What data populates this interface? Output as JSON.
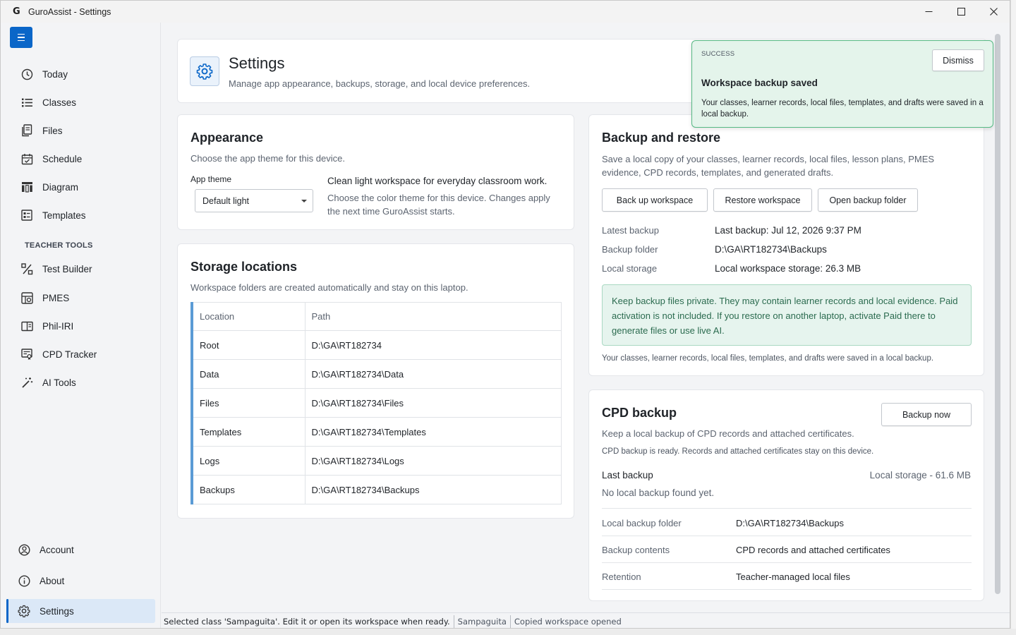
{
  "window": {
    "title": "GuroAssist - Settings"
  },
  "sidebar": {
    "items": [
      {
        "label": "Today",
        "icon": "clock-icon"
      },
      {
        "label": "Classes",
        "icon": "list-icon"
      },
      {
        "label": "Files",
        "icon": "files-icon"
      },
      {
        "label": "Schedule",
        "icon": "calendar-icon"
      },
      {
        "label": "Diagram",
        "icon": "diagram-icon"
      },
      {
        "label": "Templates",
        "icon": "template-icon"
      }
    ],
    "section_label": "TEACHER TOOLS",
    "tools": [
      {
        "label": "Test Builder",
        "icon": "percent-icon"
      },
      {
        "label": "PMES",
        "icon": "pmes-icon"
      },
      {
        "label": "Phil-IRI",
        "icon": "book-icon"
      },
      {
        "label": "CPD Tracker",
        "icon": "certificate-icon"
      },
      {
        "label": "AI Tools",
        "icon": "magic-wand-icon"
      }
    ],
    "bottom": [
      {
        "label": "Account",
        "icon": "user-icon"
      },
      {
        "label": "About",
        "icon": "info-icon"
      },
      {
        "label": "Settings",
        "icon": "gear-icon",
        "active": true
      }
    ]
  },
  "header": {
    "title": "Settings",
    "subtitle": "Manage app appearance, backups, storage, and local device preferences."
  },
  "appearance": {
    "title": "Appearance",
    "subtitle": "Choose the app theme for this device.",
    "theme_label": "App theme",
    "theme_value": "Default light",
    "description_title": "Clean light workspace for everyday classroom work.",
    "description_text": "Choose the color theme for this device. Changes apply the next time GuroAssist starts."
  },
  "storage": {
    "title": "Storage locations",
    "subtitle": "Workspace folders are created automatically and stay on this laptop.",
    "columns": [
      "Location",
      "Path"
    ],
    "rows": [
      [
        "Root",
        "D:\\GA\\RT182734"
      ],
      [
        "Data",
        "D:\\GA\\RT182734\\Data"
      ],
      [
        "Files",
        "D:\\GA\\RT182734\\Files"
      ],
      [
        "Templates",
        "D:\\GA\\RT182734\\Templates"
      ],
      [
        "Logs",
        "D:\\GA\\RT182734\\Logs"
      ],
      [
        "Backups",
        "D:\\GA\\RT182734\\Backups"
      ]
    ]
  },
  "backup": {
    "title": "Backup and restore",
    "subtitle": "Save a local copy of your classes, learner records, local files, lesson plans, PMES evidence, CPD records, templates, and generated drafts.",
    "buttons": [
      "Back up workspace",
      "Restore workspace",
      "Open backup folder"
    ],
    "details": [
      {
        "label": "Latest backup",
        "value": "Last backup: Jul 12, 2026 9:37 PM"
      },
      {
        "label": "Backup folder",
        "value": "D:\\GA\\RT182734\\Backups"
      },
      {
        "label": "Local storage",
        "value": "Local workspace storage: 26.3 MB"
      }
    ],
    "notice": "Keep backup files private. They may contain learner records and local evidence. Paid activation is not included. If you restore on another laptop, activate Paid there to generate files or use live AI.",
    "footnote": "Your classes, learner records, local files, templates, and drafts were saved in a local backup."
  },
  "cpd": {
    "title": "CPD backup",
    "subtitle": "Keep a local backup of CPD records and attached certificates.",
    "status": "CPD backup is ready. Records and attached certificates stay on this device.",
    "button": "Backup now",
    "last_backup_label": "Last backup",
    "last_backup_value": "No local backup found yet.",
    "storage_summary": "Local storage - 61.6 MB",
    "rows": [
      {
        "label": "Local backup folder",
        "value": "D:\\GA\\RT182734\\Backups"
      },
      {
        "label": "Backup contents",
        "value": "CPD records and attached certificates"
      },
      {
        "label": "Retention",
        "value": "Teacher-managed local files"
      }
    ]
  },
  "toast": {
    "kind": "SUCCESS",
    "title": "Workspace backup saved",
    "message": "Your classes, learner records, local files, templates, and drafts were saved in a local backup.",
    "dismiss": "Dismiss"
  },
  "statusbar": {
    "message": "Selected class 'Sampaguita'. Edit it or open its workspace when ready.",
    "class_name": "Sampaguita",
    "state": "Copied workspace opened"
  },
  "colors": {
    "accent": "#0a66c8",
    "success_bg": "#e4f4eb",
    "success_border": "#56b984",
    "notice_text": "#2b6b4f"
  }
}
